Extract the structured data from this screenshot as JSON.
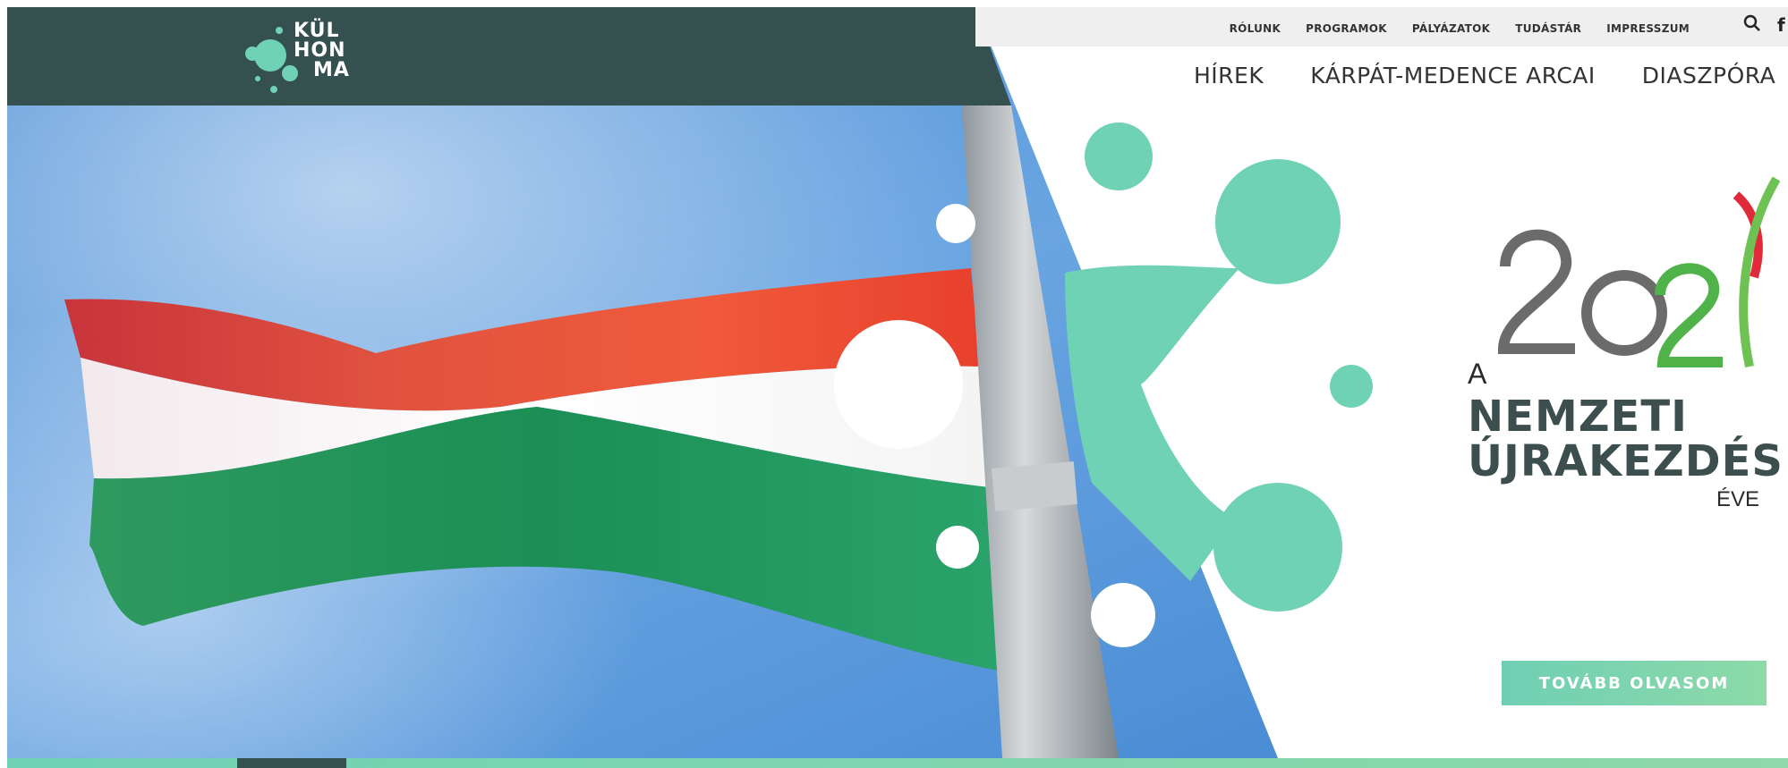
{
  "brand": {
    "logo_text": [
      "KÜL",
      "HON",
      "MA"
    ],
    "colors": {
      "header_dark": "#34504f",
      "accent_mint": "#6fd2b5",
      "accent_green": "#8ed8a9",
      "flag_red": "#e2352a",
      "flag_green": "#1f9c5c"
    }
  },
  "utility_nav": {
    "items": [
      "RÓLUNK",
      "PROGRAMOK",
      "PÁLYÁZATOK",
      "TUDÁSTÁR",
      "IMPRESSZUM"
    ],
    "search_icon": "search-icon",
    "facebook_label": "f"
  },
  "main_nav": {
    "items": [
      "HÍREK",
      "KÁRPÁT-MEDENCE ARCAI",
      "DIASZPÓRA"
    ]
  },
  "campaign": {
    "year": "2021",
    "prefix": "A",
    "line1": "NEMZETI",
    "line2": "ÚJRAKEZDÉS",
    "suffix": "ÉVE"
  },
  "hero": {
    "cta_label": "TOVÁBB OLVASOM"
  }
}
